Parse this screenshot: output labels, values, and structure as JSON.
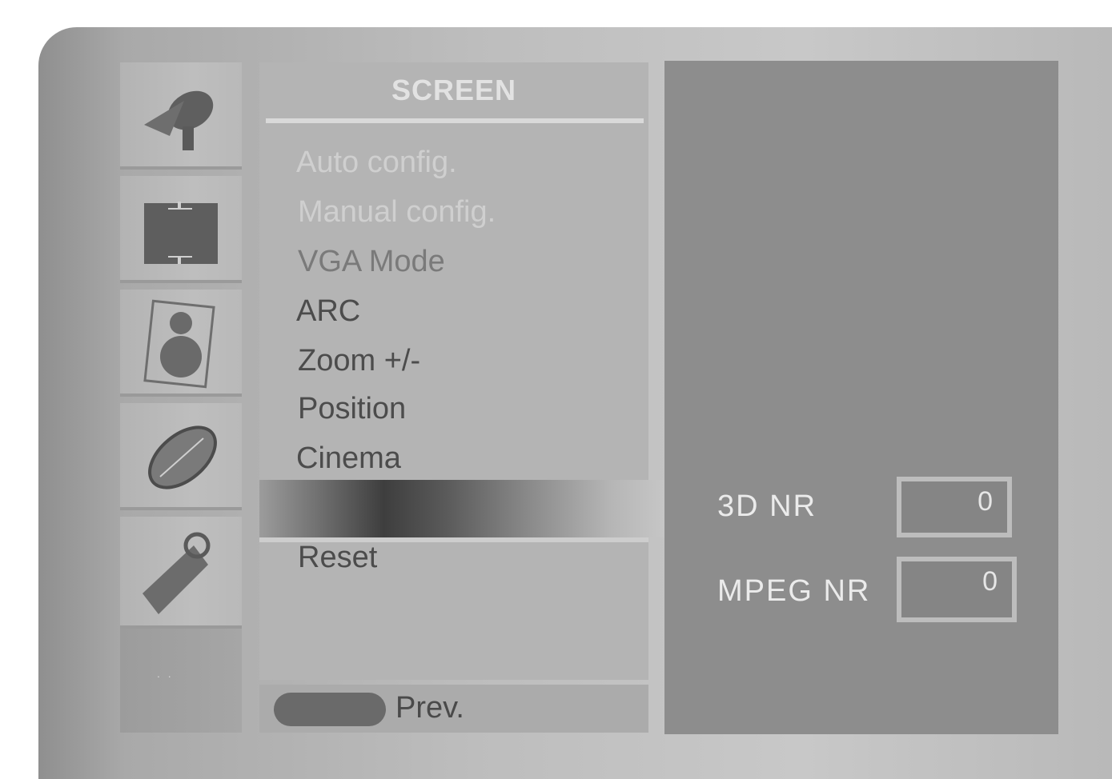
{
  "menu": {
    "title": "SCREEN",
    "items": [
      {
        "label": "Auto config."
      },
      {
        "label": "Manual config."
      },
      {
        "label": "VGA Mode"
      },
      {
        "label": "ARC"
      },
      {
        "label": "Zoom +/-"
      },
      {
        "label": "Position"
      },
      {
        "label": "Cinema"
      },
      {
        "label": ""
      },
      {
        "label": "Reset"
      }
    ]
  },
  "footer": {
    "prev_label": "Prev."
  },
  "submenu": {
    "rows": [
      {
        "label": "3D NR",
        "value": "0"
      },
      {
        "label": "MPEG NR",
        "value": "0"
      }
    ]
  },
  "side_icons": [
    "satellite-dish-icon",
    "screen-icon",
    "picture-icon",
    "audio-disc-icon",
    "option-tag-icon"
  ],
  "dots_text": ". ."
}
